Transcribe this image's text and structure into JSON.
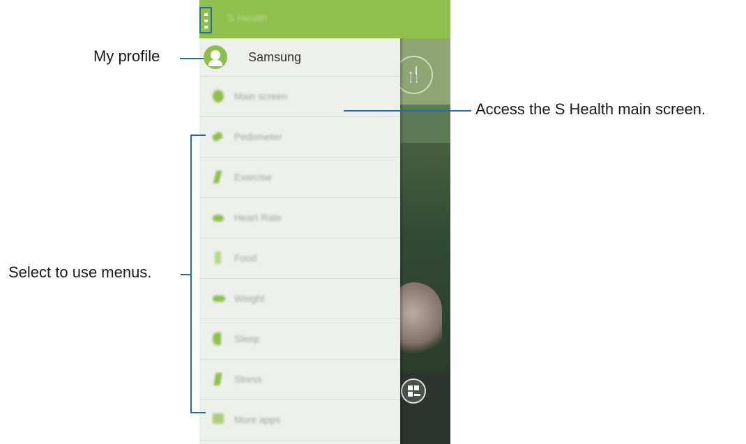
{
  "app": {
    "title": "S Health"
  },
  "drawer": {
    "profile_name": "Samsung",
    "items": [
      {
        "label": "Main screen",
        "icon": "home-circle-icon"
      },
      {
        "label": "Pedometer",
        "icon": "shoe-icon"
      },
      {
        "label": "Exercise",
        "icon": "runner-icon"
      },
      {
        "label": "Heart Rate",
        "icon": "heart-icon"
      },
      {
        "label": "Food",
        "icon": "cup-icon"
      },
      {
        "label": "Weight",
        "icon": "scale-icon"
      },
      {
        "label": "Sleep",
        "icon": "moon-icon"
      },
      {
        "label": "Stress",
        "icon": "stress-icon"
      },
      {
        "label": "More apps",
        "icon": "grid-icon"
      }
    ]
  },
  "callouts": {
    "my_profile": "My profile",
    "main_screen": "Access the S Health main screen.",
    "menus": "Select to use menus."
  },
  "colors": {
    "accent_green": "#8fc04d",
    "callout_blue": "#1e6fa9"
  }
}
